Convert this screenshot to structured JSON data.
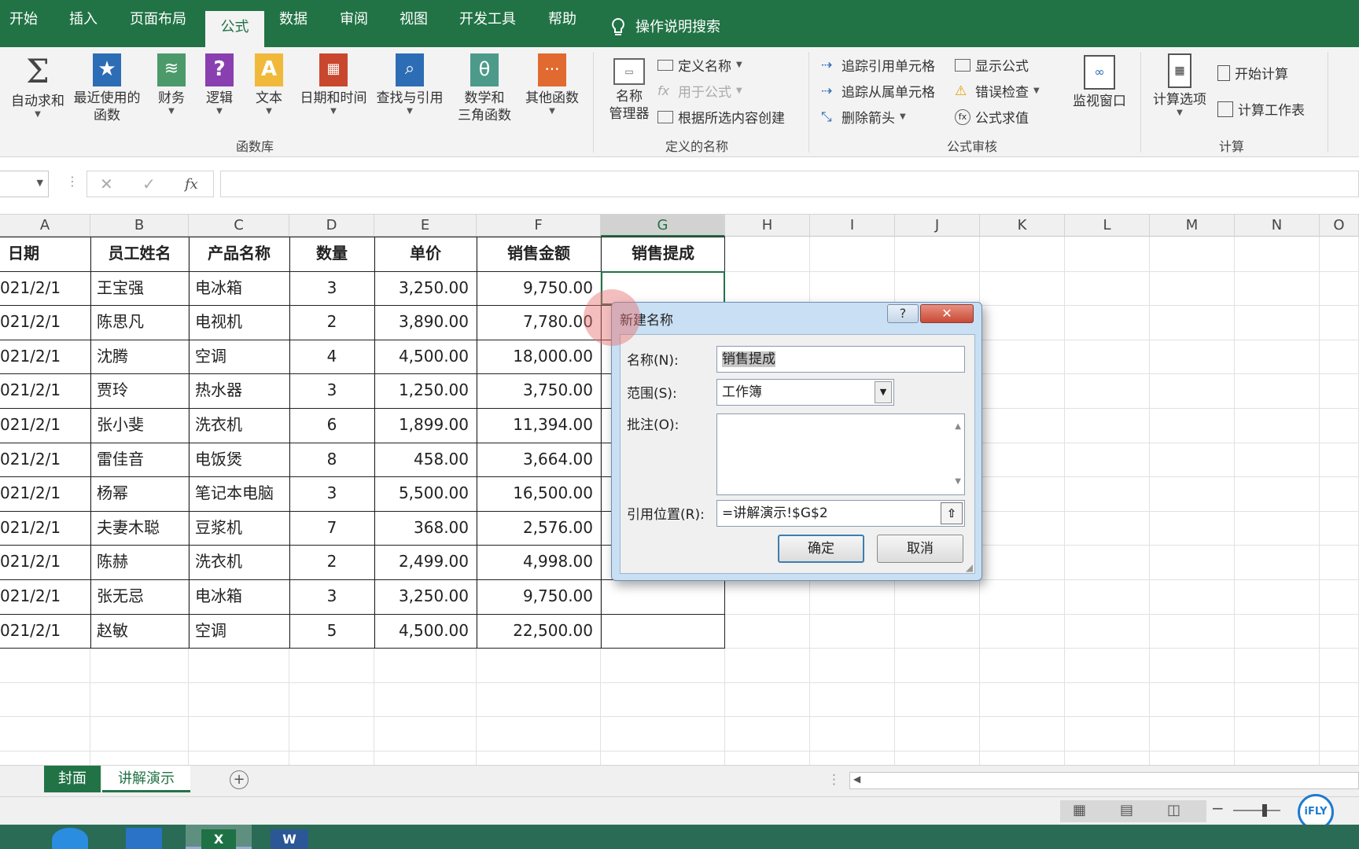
{
  "ribbon_tabs": [
    {
      "label": "开始"
    },
    {
      "label": "插入"
    },
    {
      "label": "页面布局"
    },
    {
      "label": "公式",
      "active": true
    },
    {
      "label": "数据"
    },
    {
      "label": "审阅"
    },
    {
      "label": "视图"
    },
    {
      "label": "开发工具"
    },
    {
      "label": "帮助"
    }
  ],
  "tell_me": "操作说明搜索",
  "ribbon": {
    "function_library": {
      "group_label": "函数库",
      "autosum": "自动求和",
      "recent_l1": "最近使用的",
      "recent_l2": "函数",
      "financial": "财务",
      "logical": "逻辑",
      "text": "文本",
      "datetime": "日期和时间",
      "lookup": "查找与引用",
      "math_l1": "数学和",
      "math_l2": "三角函数",
      "more": "其他函数"
    },
    "defined_names": {
      "group_label": "定义的名称",
      "name_mgr_l1": "名称",
      "name_mgr_l2": "管理器",
      "define_name": "定义名称",
      "use_in_formula": "用于公式",
      "create_from_sel": "根据所选内容创建"
    },
    "formula_auditing": {
      "group_label": "公式审核",
      "trace_precedents": "追踪引用单元格",
      "trace_dependents": "追踪从属单元格",
      "remove_arrows": "删除箭头",
      "show_formulas": "显示公式",
      "error_checking": "错误检查",
      "evaluate_formula": "公式求值",
      "watch_window": "监视窗口"
    },
    "calculation": {
      "group_label": "计算",
      "calc_options": "计算选项",
      "calc_now": "开始计算",
      "calc_sheet": "计算工作表"
    }
  },
  "formula_bar": {
    "fx": "fx",
    "cancel": "✕",
    "enter": "✓",
    "value": ""
  },
  "columns": [
    "A",
    "B",
    "C",
    "D",
    "E",
    "F",
    "G",
    "H",
    "I",
    "J",
    "K",
    "L",
    "M",
    "N",
    "O"
  ],
  "table": {
    "headers": [
      "日期",
      "员工姓名",
      "产品名称",
      "数量",
      "单价",
      "销售金额",
      "销售提成"
    ],
    "rows": [
      [
        "021/2/1",
        "王宝强",
        "电冰箱",
        "3",
        "3,250.00",
        "9,750.00",
        ""
      ],
      [
        "021/2/1",
        "陈思凡",
        "电视机",
        "2",
        "3,890.00",
        "7,780.00",
        ""
      ],
      [
        "021/2/1",
        "沈腾",
        "空调",
        "4",
        "4,500.00",
        "18,000.00",
        ""
      ],
      [
        "021/2/1",
        "贾玲",
        "热水器",
        "3",
        "1,250.00",
        "3,750.00",
        ""
      ],
      [
        "021/2/1",
        "张小斐",
        "洗衣机",
        "6",
        "1,899.00",
        "11,394.00",
        ""
      ],
      [
        "021/2/1",
        "雷佳音",
        "电饭煲",
        "8",
        "458.00",
        "3,664.00",
        ""
      ],
      [
        "021/2/1",
        "杨幂",
        "笔记本电脑",
        "3",
        "5,500.00",
        "16,500.00",
        ""
      ],
      [
        "021/2/1",
        "夫妻木聪",
        "豆浆机",
        "7",
        "368.00",
        "2,576.00",
        ""
      ],
      [
        "021/2/1",
        "陈赫",
        "洗衣机",
        "2",
        "2,499.00",
        "4,998.00",
        ""
      ],
      [
        "021/2/1",
        "张无忌",
        "电冰箱",
        "3",
        "3,250.00",
        "9,750.00",
        ""
      ],
      [
        "021/2/1",
        "赵敏",
        "空调",
        "5",
        "4,500.00",
        "22,500.00",
        ""
      ]
    ]
  },
  "sheet_tabs": [
    {
      "label": "封面"
    },
    {
      "label": "讲解演示",
      "active": true
    }
  ],
  "dialog": {
    "title": "新建名称",
    "help": "?",
    "close": "✕",
    "name_label": "名称(N):",
    "name_value": "销售提成",
    "scope_label": "范围(S):",
    "scope_value": "工作簿",
    "comment_label": "批注(O):",
    "comment_value": "",
    "ref_label": "引用位置(R):",
    "ref_value": "=讲解演示!$G$2",
    "ok": "确定",
    "cancel": "取消"
  },
  "brand_badge": "iFLY",
  "colors": {
    "excel_green": "#217346",
    "dialog_frame": "#c9dff3"
  }
}
